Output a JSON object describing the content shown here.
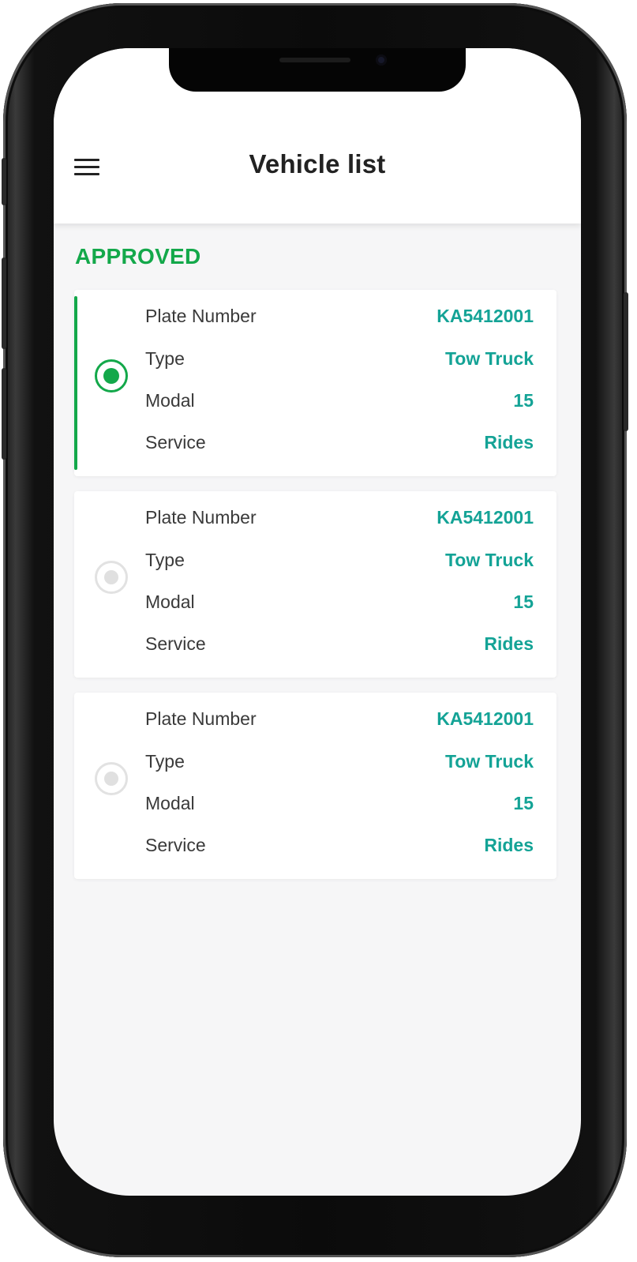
{
  "header": {
    "title": "Vehicle list",
    "menu_icon": "hamburger-menu-icon"
  },
  "section": {
    "label": "APPROVED"
  },
  "colors": {
    "accent_green": "#13a84a",
    "value_teal": "#14a396",
    "radio_inactive": "#e0e0e0",
    "background": "#f6f6f7"
  },
  "vehicles": [
    {
      "selected": true,
      "plate_label": "Plate Number",
      "plate": "KA5412001",
      "type_label": "Type",
      "type": "Tow Truck",
      "modal_label": "Modal",
      "modal": "15",
      "service_label": "Service",
      "service": "Rides"
    },
    {
      "selected": false,
      "plate_label": "Plate Number",
      "plate": "KA5412001",
      "type_label": "Type",
      "type": "Tow Truck",
      "modal_label": "Modal",
      "modal": "15",
      "service_label": "Service",
      "service": "Rides"
    },
    {
      "selected": false,
      "plate_label": "Plate Number",
      "plate": "KA5412001",
      "type_label": "Type",
      "type": "Tow Truck",
      "modal_label": "Modal",
      "modal": "15",
      "service_label": "Service",
      "service": "Rides"
    }
  ]
}
